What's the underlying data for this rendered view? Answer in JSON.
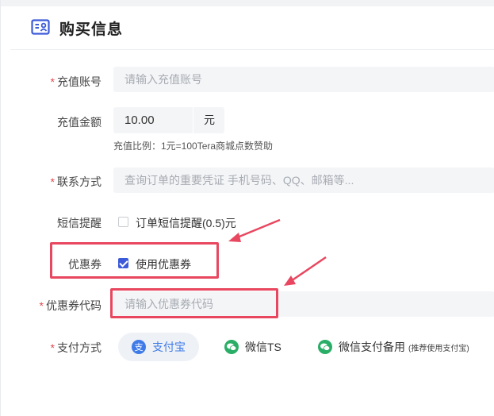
{
  "header": {
    "title": "购买信息",
    "icon": "id-card-icon"
  },
  "form": {
    "account": {
      "label": "充值账号",
      "required": true,
      "placeholder": "请输入充值账号"
    },
    "amount": {
      "label": "充值金额",
      "value": "10.00",
      "unit": "元",
      "hint": "充值比例：1元=100Tera商城点数赞助"
    },
    "contact": {
      "label": "联系方式",
      "required": true,
      "placeholder": "查询订单的重要凭证 手机号码、QQ、邮箱等..."
    },
    "sms": {
      "label": "短信提醒",
      "checkbox_label": "订单短信提醒(0.5)元",
      "checked": false
    },
    "coupon": {
      "label": "优惠券",
      "checkbox_label": "使用优惠券",
      "checked": true
    },
    "coupon_code": {
      "label": "优惠券代码",
      "required": true,
      "placeholder": "请输入优惠券代码"
    },
    "payment": {
      "label": "支付方式",
      "required": true,
      "options": [
        {
          "label": "支付宝",
          "icon": "alipay-icon",
          "selected": true
        },
        {
          "label": "微信TS",
          "icon": "wechat-icon",
          "selected": false
        },
        {
          "label": "微信支付备用",
          "note": "(推荐使用支付宝)",
          "icon": "wechat-icon",
          "selected": false
        }
      ]
    }
  },
  "required_mark": "*",
  "colors": {
    "accent": "#3d5bd9",
    "alipay": "#3f7be8",
    "wechat": "#2aae67",
    "annotation": "#e8475f",
    "required": "#e5484d"
  }
}
